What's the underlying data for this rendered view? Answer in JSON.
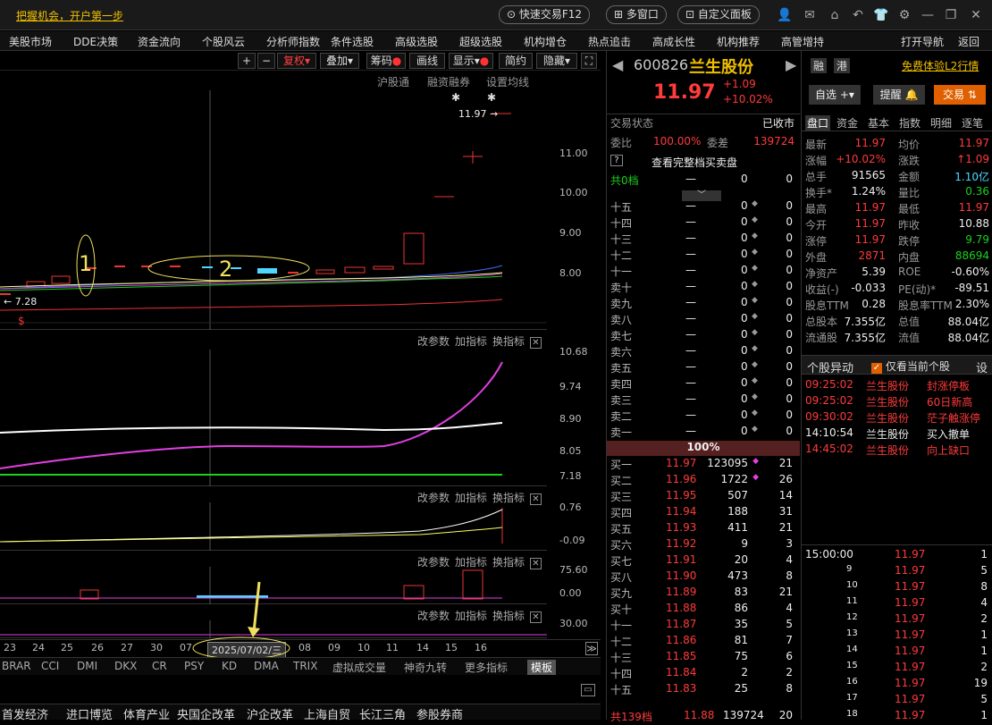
{
  "titlebar": {
    "promo": "把握机会，开户第一步",
    "quick_trade": "快速交易F12",
    "multi_window": "多窗口",
    "custom_panel": "自定义面板"
  },
  "menu": [
    "美股市场",
    "DDE决策",
    "资金流向",
    "个股风云",
    "分析师指数",
    "条件选股",
    "高级选股",
    "超级选股",
    "机构增仓",
    "热点追击",
    "高成长性",
    "机构推荐",
    "高管增持",
    "打开导航",
    "返回"
  ],
  "toolbar": {
    "fuquan": "复权",
    "diejia": "叠加",
    "chouma": "筹码",
    "huaxian": "画线",
    "xianshi": "显示",
    "jianyue": "简约",
    "yincang": "隐藏"
  },
  "subbar": [
    "沪股通",
    "融资融券",
    "设置均线"
  ],
  "price_pane": {
    "last_label": "11.97",
    "low_label": "7.28",
    "annot1": "1",
    "annot2": "2",
    "axis": [
      "11.00",
      "10.00",
      "9.00",
      "8.00"
    ]
  },
  "panel_tools": [
    "改参数",
    "加指标",
    "换指标"
  ],
  "p2_axis": [
    "10.68",
    "9.74",
    "8.90",
    "8.05",
    "7.18"
  ],
  "p3_axis": [
    "0.76",
    "-0.09"
  ],
  "p4_axis": [
    "75.60",
    "0.00"
  ],
  "p5_axis": [
    "30.00"
  ],
  "dates": [
    "23",
    "24",
    "25",
    "26",
    "27",
    "30",
    "07",
    "08",
    "09",
    "10",
    "11",
    "14",
    "15",
    "16"
  ],
  "selected_date": "2025/07/02/三",
  "indicators": [
    "BRAR",
    "CCI",
    "DMI",
    "DKX",
    "CR",
    "PSY",
    "KD",
    "DMA",
    "TRIX",
    "虚拟成交量",
    "神奇九转",
    "更多指标",
    "模板"
  ],
  "bottom_tabs": [
    "首发经济",
    "进口博览",
    "体育产业",
    "央国企改革",
    "沪企改革",
    "上海自贸",
    "长江三角",
    "参股券商"
  ],
  "stock": {
    "code": "600826",
    "name": "兰生股份",
    "price": "11.97",
    "change": "+1.09",
    "pct": "+10.02%",
    "rong": "融",
    "gang": "港",
    "l2": "免费体验L2行情",
    "zixuan": "自选",
    "tixing": "提醒",
    "jiaoyi": "交易"
  },
  "trade_status": {
    "label": "交易状态",
    "value": "已收市",
    "weibi_label": "委比",
    "weibi": "100.00%",
    "weicha_label": "委差",
    "weicha": "139724",
    "full_book": "查看完整档买卖盘",
    "total_sell": "共0档",
    "pct100": "100%"
  },
  "sells": [
    "十五",
    "十四",
    "十三",
    "十二",
    "十一",
    "卖十",
    "卖九",
    "卖八",
    "卖七",
    "卖六",
    "卖五",
    "卖四",
    "卖三",
    "卖二",
    "卖一"
  ],
  "buys": [
    {
      "l": "买一",
      "p": "11.97",
      "v": "123095",
      "n": "21"
    },
    {
      "l": "买二",
      "p": "11.96",
      "v": "1722",
      "n": "26"
    },
    {
      "l": "买三",
      "p": "11.95",
      "v": "507",
      "n": "14"
    },
    {
      "l": "买四",
      "p": "11.94",
      "v": "188",
      "n": "31"
    },
    {
      "l": "买五",
      "p": "11.93",
      "v": "411",
      "n": "21"
    },
    {
      "l": "买六",
      "p": "11.92",
      "v": "9",
      "n": "3"
    },
    {
      "l": "买七",
      "p": "11.91",
      "v": "20",
      "n": "4"
    },
    {
      "l": "买八",
      "p": "11.90",
      "v": "473",
      "n": "8"
    },
    {
      "l": "买九",
      "p": "11.89",
      "v": "83",
      "n": "21"
    },
    {
      "l": "买十",
      "p": "11.88",
      "v": "86",
      "n": "4"
    },
    {
      "l": "十一",
      "p": "11.87",
      "v": "35",
      "n": "5"
    },
    {
      "l": "十二",
      "p": "11.86",
      "v": "81",
      "n": "7"
    },
    {
      "l": "十三",
      "p": "11.85",
      "v": "75",
      "n": "6"
    },
    {
      "l": "十四",
      "p": "11.84",
      "v": "2",
      "n": "2"
    },
    {
      "l": "十五",
      "p": "11.83",
      "v": "25",
      "n": "8"
    }
  ],
  "total_buy": {
    "l": "共139档",
    "p": "11.88",
    "v": "139724",
    "n": "20"
  },
  "tabs": [
    "盘口",
    "资金",
    "基本",
    "指数",
    "明细",
    "逐笔"
  ],
  "quote": [
    [
      "最新",
      "11.97",
      "均价",
      "11.97"
    ],
    [
      "涨幅",
      "+10.02%",
      "涨跌",
      "↑1.09"
    ],
    [
      "总手",
      "91565",
      "金额",
      "1.10亿"
    ],
    [
      "换手*",
      "1.24%",
      "量比",
      "0.36"
    ],
    [
      "最高",
      "11.97",
      "最低",
      "11.97"
    ],
    [
      "今开",
      "11.97",
      "昨收",
      "10.88"
    ],
    [
      "涨停",
      "11.97",
      "跌停",
      "9.79"
    ],
    [
      "外盘",
      "2871",
      "内盘",
      "88694"
    ],
    [
      "净资产",
      "5.39",
      "ROE",
      "-0.60%"
    ],
    [
      "收益(-)",
      "-0.033",
      "PE(动)*",
      "-89.51"
    ],
    [
      "股息TTM",
      "0.28",
      "股息率TTM",
      "2.30%"
    ],
    [
      "总股本",
      "7.355亿",
      "总值",
      "88.04亿"
    ],
    [
      "流通股",
      "7.355亿",
      "流值",
      "88.04亿"
    ]
  ],
  "alerts": {
    "title": "个股异动",
    "check": "仅看当前个股",
    "settings": "设",
    "rows": [
      [
        "09:25:02",
        "兰生股份",
        "封涨停板"
      ],
      [
        "09:25:02",
        "兰生股份",
        "60日新高"
      ],
      [
        "09:30:02",
        "兰生股份",
        "茫子触涨停"
      ],
      [
        "14:10:54",
        "兰生股份",
        "买入撤单"
      ],
      [
        "14:45:02",
        "兰生股份",
        "向上缺口"
      ]
    ]
  },
  "ticks": [
    [
      "15:00:00",
      "11.97",
      "1"
    ],
    [
      "9",
      "11.97",
      "5"
    ],
    [
      "10",
      "11.97",
      "8"
    ],
    [
      "11",
      "11.97",
      "4"
    ],
    [
      "12",
      "11.97",
      "2"
    ],
    [
      "13",
      "11.97",
      "1"
    ],
    [
      "14",
      "11.97",
      "1"
    ],
    [
      "15",
      "11.97",
      "2"
    ],
    [
      "16",
      "11.97",
      "19"
    ],
    [
      "17",
      "11.97",
      "5"
    ],
    [
      "18",
      "11.97",
      "1"
    ]
  ]
}
